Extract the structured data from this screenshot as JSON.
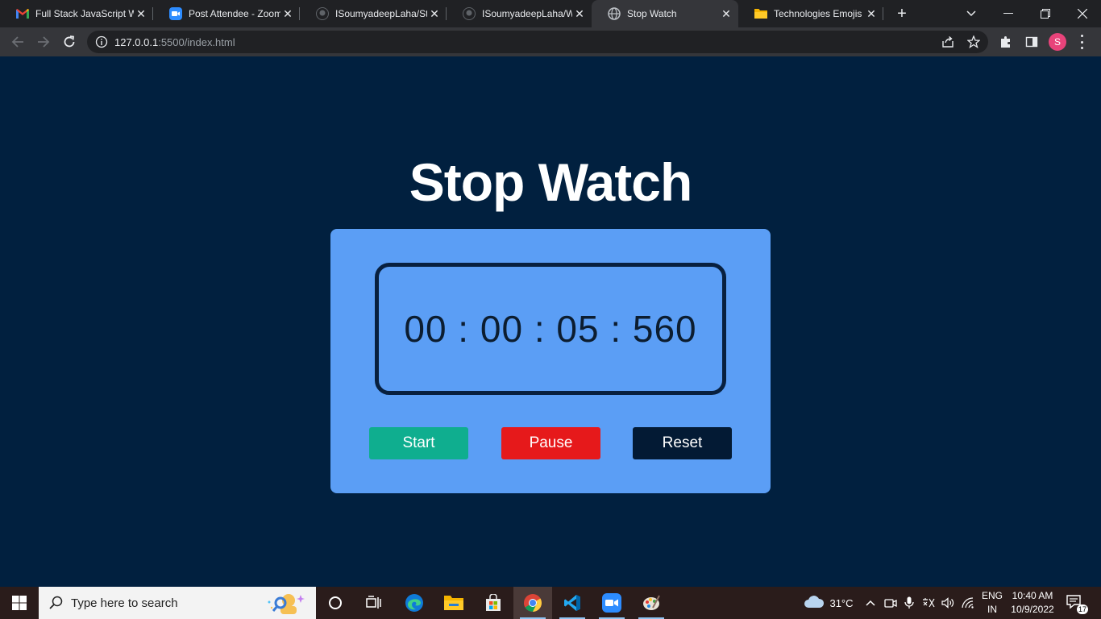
{
  "browser": {
    "tabs": [
      {
        "title": "Full Stack JavaScript W",
        "icon": "gmail-icon"
      },
      {
        "title": "Post Attendee - Zoom",
        "icon": "zoom-icon"
      },
      {
        "title": "ISoumyadeepLaha/Stc",
        "icon": "github-icon"
      },
      {
        "title": "ISoumyadeepLaha/Wc",
        "icon": "github-icon"
      },
      {
        "title": "Stop Watch",
        "icon": "globe-icon",
        "active": true
      },
      {
        "title": "Technologies Emojis |",
        "icon": "folder-icon"
      }
    ],
    "url_host": "127.0.0.1",
    "url_rest": ":5500/index.html",
    "profile_initial": "S"
  },
  "page": {
    "heading": "Stop Watch",
    "time": "00 : 00 : 05 : 560",
    "buttons": {
      "start": "Start",
      "pause": "Pause",
      "reset": "Reset"
    },
    "colors": {
      "background": "#01203f",
      "card": "#5b9ef5",
      "start": "#0fae8f",
      "pause": "#e6191b",
      "reset": "#031a34"
    }
  },
  "taskbar": {
    "search_placeholder": "Type here to search",
    "weather": "31°C",
    "lang_line1": "ENG",
    "lang_line2": "IN",
    "time": "10:40 AM",
    "date": "10/9/2022",
    "notification_count": "17"
  }
}
